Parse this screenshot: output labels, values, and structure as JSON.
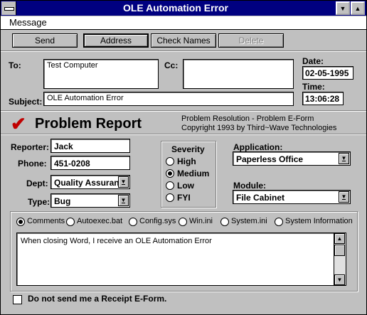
{
  "window": {
    "title": "OLE Automation Error"
  },
  "menu": {
    "message": "Message"
  },
  "toolbar": {
    "send": "Send",
    "address": "Address",
    "check_names": "Check Names",
    "delete": "Delete"
  },
  "header": {
    "to_label": "To:",
    "to_value": "Test Computer",
    "cc_label": "Cc:",
    "cc_value": "",
    "subject_label": "Subject:",
    "subject_value": "OLE Automation Error",
    "date_label": "Date:",
    "date_value": "02-05-1995",
    "time_label": "Time:",
    "time_value": "13:06:28"
  },
  "form": {
    "title": "Problem Report",
    "info_line1": "Problem Resolution - Problem E-Form",
    "info_line2": "Copyright 1993 by Third~Wave Technologies"
  },
  "reporter": {
    "label": "Reporter:",
    "value": "Jack"
  },
  "phone": {
    "label": "Phone:",
    "value": "451-0208"
  },
  "dept": {
    "label": "Dept:",
    "value": "Quality Assuran"
  },
  "type": {
    "label": "Type:",
    "value": "Bug"
  },
  "severity": {
    "title": "Severity",
    "options": [
      "High",
      "Medium",
      "Low",
      "FYI"
    ],
    "selected": "Medium"
  },
  "application": {
    "label": "Application:",
    "value": "Paperless Office"
  },
  "module": {
    "label": "Module:",
    "value": "File Cabinet"
  },
  "tabs": {
    "options": [
      "Comments",
      "Autoexec.bat",
      "Config.sys",
      "Win.ini",
      "System.ini",
      "System Information"
    ],
    "selected": "Comments"
  },
  "comments": {
    "text": "When closing Word, I receive an OLE Automation Error"
  },
  "receipt": {
    "label": "Do not send me a Receipt E-Form.",
    "checked": false
  },
  "icons": {
    "system_menu": "system-menu-icon",
    "minimize": "minimize-icon",
    "maximize": "maximize-icon",
    "checkmark": "checkmark-icon"
  },
  "colors": {
    "titlebar": "#000080",
    "checkmark": "#c00000",
    "face": "#c0c0c0"
  }
}
